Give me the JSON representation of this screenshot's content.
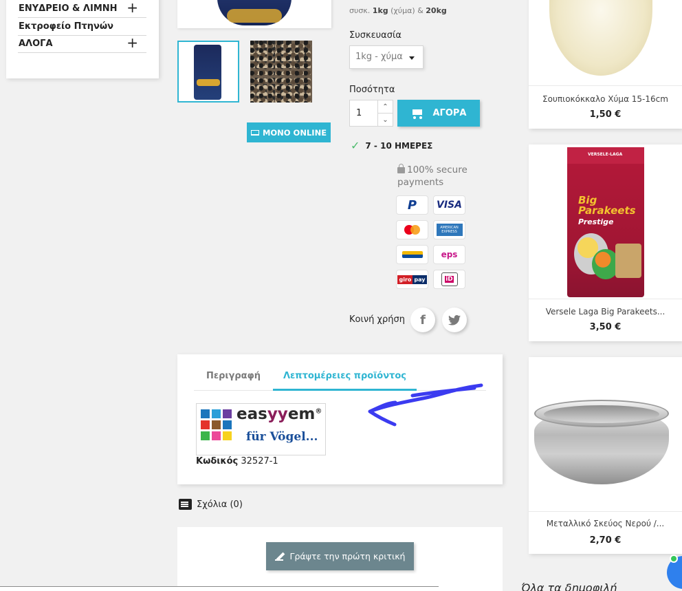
{
  "sidebar": {
    "items": [
      {
        "label": "ΕΝΥΔΡΕΙΟ & ΛΙΜΝΗ",
        "expandable": true
      },
      {
        "label": "Εκτροφείο Πτηνών",
        "expandable": false
      },
      {
        "label": "ΑΛΟΓΑ",
        "expandable": true
      }
    ],
    "plus_symbol": "+"
  },
  "gallery": {
    "online_badge": "ΜΟΝΟ ONLINE"
  },
  "product": {
    "pack_note_prefix": "συσκ.",
    "pack_note_size1": "1kg",
    "pack_note_unit": "(χύμα)",
    "pack_note_amp": "&",
    "pack_note_size2": "20kg",
    "packaging_label": "Συσκευασία",
    "packaging_value": "1kg - χύμα",
    "quantity_label": "Ποσότητα",
    "quantity_value": "1",
    "buy_label": "ΑΓΟΡΑ",
    "delivery": "7 - 10 ΗΜΕΡΕΣ",
    "secure_text": "100% secure payments",
    "payments": [
      "paypal",
      "visa",
      "mastercard",
      "american-express",
      "sofort",
      "eps",
      "giropay",
      "ideal"
    ],
    "payment_texts": {
      "visa": "VISA",
      "amex": "AMERICAN EXPRESS",
      "eps": "eps",
      "giro1": "giro",
      "giro2": "pay",
      "ideal": "iD"
    },
    "share_label": "Κοινή χρήση",
    "share_icons": [
      "facebook-icon",
      "twitter-icon"
    ]
  },
  "tabs": {
    "items": [
      {
        "label": "Περιγραφή",
        "active": false
      },
      {
        "label": "Λεπτομέρειες προϊόντος",
        "active": true
      }
    ],
    "brand": {
      "name_a": "eas",
      "name_b": "yy",
      "name_c": "em",
      "reg": "®",
      "tagline": "für Vögel..."
    },
    "code_label": "Κωδικός",
    "code_value": "32527-1"
  },
  "comments": {
    "label": "Σχόλια (0)",
    "write_review": "Γράψτε την πρώτη κριτική"
  },
  "related": [
    {
      "name": "Σουπιοκόκκαλο Χύμα 15-16cm",
      "price": "1,50 €"
    },
    {
      "name": "Versele Laga Big Parakeets...",
      "price": "3,50 €",
      "img_text_brand": "VERSELE-LAGA",
      "img_text_title": "Big Parakeets",
      "img_text_sub": "Prestige"
    },
    {
      "name": "Μεταλλικό Σκεύος Νερού /...",
      "price": "2,70 €"
    }
  ],
  "popular_heading": "Όλα τα δημοφιλή",
  "colors": {
    "accent": "#2fb5d2",
    "review_button": "#6c868e",
    "annotation_arrow": "#3b3bf0"
  }
}
